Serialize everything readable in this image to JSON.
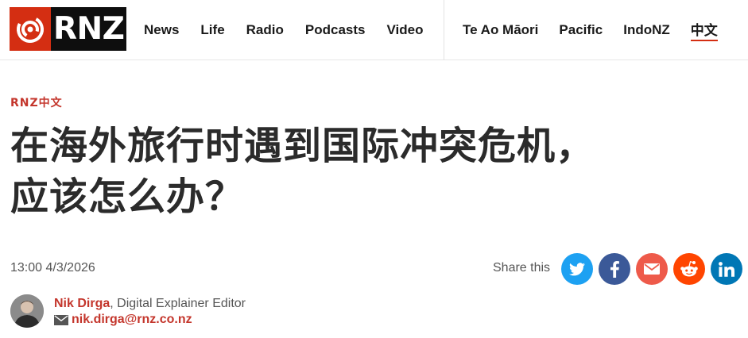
{
  "brand": {
    "name": "RNZ"
  },
  "nav": {
    "primary": [
      "News",
      "Life",
      "Radio",
      "Podcasts",
      "Video"
    ],
    "secondary": [
      "Te Ao Māori",
      "Pacific",
      "IndoNZ",
      "中文"
    ],
    "active": "中文"
  },
  "article": {
    "kicker": "RNZ中文",
    "title_line1": "在海外旅行时遇到国际冲突危机，",
    "title_line2": "应该怎么办？",
    "timestamp": "13:00 4/3/2026",
    "share_label": "Share this"
  },
  "author": {
    "name": "Nik Dirga",
    "role": ", Digital Explainer Editor",
    "email": "nik.dirga@rnz.co.nz"
  },
  "colors": {
    "brand_red": "#d42e12",
    "kicker_red": "#c4362c",
    "twitter": "#1da1f2",
    "facebook": "#3b5998",
    "email": "#ee5a4a",
    "reddit": "#ff4500",
    "linkedin": "#0077b5"
  },
  "icons": [
    "twitter-icon",
    "facebook-icon",
    "email-icon",
    "reddit-icon",
    "linkedin-icon",
    "mail-icon"
  ]
}
